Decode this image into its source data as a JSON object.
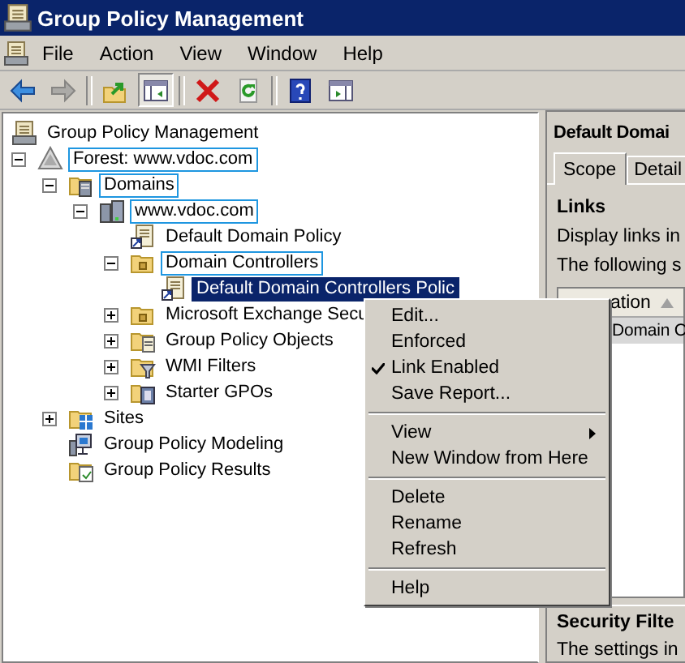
{
  "window": {
    "title": "Group Policy Management"
  },
  "menu": [
    "File",
    "Action",
    "View",
    "Window",
    "Help"
  ],
  "toolbar": [
    {
      "kind": "back",
      "disabled": false,
      "pressed": false
    },
    {
      "kind": "forward",
      "disabled": true,
      "pressed": false
    },
    {
      "kind": "separator"
    },
    {
      "kind": "up",
      "disabled": false,
      "pressed": false
    },
    {
      "kind": "tree-pane",
      "disabled": false,
      "pressed": true
    },
    {
      "kind": "separator"
    },
    {
      "kind": "delete",
      "disabled": false,
      "pressed": false
    },
    {
      "kind": "refresh",
      "disabled": false,
      "pressed": false
    },
    {
      "kind": "separator"
    },
    {
      "kind": "help",
      "disabled": false,
      "pressed": false
    },
    {
      "kind": "action-pane",
      "disabled": false,
      "pressed": false
    }
  ],
  "tree": {
    "label": "Group Policy Management",
    "kind": "console",
    "selected": false,
    "outlined": false,
    "children": [
      {
        "label": "Forest: www.vdoc.com",
        "kind": "forest",
        "expanded": true,
        "selected": false,
        "outlined": true,
        "children": [
          {
            "label": "Domains",
            "kind": "domains",
            "expanded": true,
            "selected": false,
            "outlined": true,
            "children": [
              {
                "label": "www.vdoc.com",
                "kind": "domain",
                "expanded": true,
                "selected": false,
                "outlined": true,
                "children": [
                  {
                    "label": "Default Domain Policy",
                    "kind": "gpo-link",
                    "selected": false,
                    "outlined": false
                  },
                  {
                    "label": "Domain Controllers",
                    "kind": "ou",
                    "expanded": true,
                    "selected": false,
                    "outlined": true,
                    "children": [
                      {
                        "label": "Default Domain Controllers Polic",
                        "kind": "gpo-link",
                        "selected": true,
                        "outlined": false
                      }
                    ]
                  },
                  {
                    "label": "Microsoft Exchange Secu",
                    "kind": "ou",
                    "expanded": false,
                    "selected": false,
                    "outlined": false
                  },
                  {
                    "label": "Group Policy Objects",
                    "kind": "gpo-folder",
                    "expanded": false,
                    "selected": false,
                    "outlined": false
                  },
                  {
                    "label": "WMI Filters",
                    "kind": "filter-folder",
                    "expanded": false,
                    "selected": false,
                    "outlined": false
                  },
                  {
                    "label": "Starter GPOs",
                    "kind": "starter-folder",
                    "expanded": false,
                    "selected": false,
                    "outlined": false
                  }
                ]
              }
            ]
          },
          {
            "label": "Sites",
            "kind": "sites",
            "expanded": false,
            "selected": false,
            "outlined": false
          },
          {
            "label": "Group Policy Modeling",
            "kind": "modeling",
            "selected": false,
            "outlined": false
          },
          {
            "label": "Group Policy Results",
            "kind": "results",
            "selected": false,
            "outlined": false
          }
        ]
      }
    ]
  },
  "details": {
    "title": "Default Domai",
    "tabs": [
      {
        "label": "Scope",
        "selected": true
      },
      {
        "label": "Detail",
        "selected": false
      }
    ],
    "links_heading": "Links",
    "links_text": "Display links in",
    "following_text": "The following s",
    "table": {
      "columns": [
        {
          "label": "ation",
          "sorted": true
        }
      ],
      "rows": [
        {
          "cells": [
            "Domain C"
          ],
          "selected": true
        }
      ]
    },
    "security_heading": "Security Filte",
    "security_text": "The settings in"
  },
  "context_menu": {
    "items": [
      {
        "kind": "item",
        "label": "Edit...",
        "checked": false
      },
      {
        "kind": "item",
        "label": "Enforced",
        "checked": false
      },
      {
        "kind": "item",
        "label": "Link Enabled",
        "checked": true
      },
      {
        "kind": "item",
        "label": "Save Report...",
        "checked": false
      },
      {
        "kind": "separator"
      },
      {
        "kind": "submenu",
        "label": "View",
        "checked": false
      },
      {
        "kind": "item",
        "label": "New Window from Here",
        "checked": false
      },
      {
        "kind": "separator"
      },
      {
        "kind": "item",
        "label": "Delete",
        "checked": false
      },
      {
        "kind": "item",
        "label": "Rename",
        "checked": false
      },
      {
        "kind": "item",
        "label": "Refresh",
        "checked": false
      },
      {
        "kind": "separator"
      },
      {
        "kind": "item",
        "label": "Help",
        "checked": false
      }
    ]
  }
}
